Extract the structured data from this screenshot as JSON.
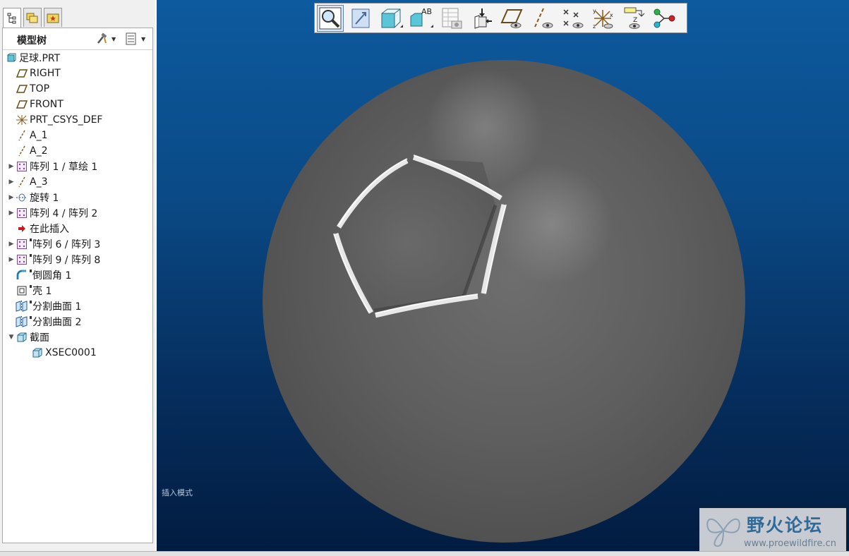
{
  "model_tree": {
    "title": "模型树",
    "items": [
      {
        "label": "足球.PRT",
        "icon": "part-icon",
        "level": 0,
        "expander": ""
      },
      {
        "label": "RIGHT",
        "icon": "datum-plane-icon",
        "level": 1,
        "expander": ""
      },
      {
        "label": "TOP",
        "icon": "datum-plane-icon",
        "level": 1,
        "expander": ""
      },
      {
        "label": "FRONT",
        "icon": "datum-plane-icon",
        "level": 1,
        "expander": ""
      },
      {
        "label": "PRT_CSYS_DEF",
        "icon": "coordinate-system-icon",
        "level": 1,
        "expander": ""
      },
      {
        "label": "A_1",
        "icon": "datum-axis-icon",
        "level": 1,
        "expander": ""
      },
      {
        "label": "A_2",
        "icon": "datum-axis-icon",
        "level": 1,
        "expander": ""
      },
      {
        "label": "阵列 1 / 草绘 1",
        "icon": "pattern-icon",
        "level": 1,
        "expander": "collapsed"
      },
      {
        "label": "A_3",
        "icon": "datum-axis-icon",
        "level": 1,
        "expander": "collapsed"
      },
      {
        "label": "旋转 1",
        "icon": "revolve-icon",
        "level": 1,
        "expander": "collapsed"
      },
      {
        "label": "阵列 4 / 阵列 2",
        "icon": "pattern-icon",
        "level": 1,
        "expander": "collapsed"
      },
      {
        "label": "在此插入",
        "icon": "insert-here-arrow-icon",
        "level": 1,
        "expander": ""
      },
      {
        "label": "阵列 6 / 阵列 3",
        "icon": "pattern-icon",
        "level": 1,
        "expander": "collapsed",
        "badge": true
      },
      {
        "label": "阵列 9 / 阵列 8",
        "icon": "pattern-icon",
        "level": 1,
        "expander": "collapsed",
        "badge": true
      },
      {
        "label": "倒圆角 1",
        "icon": "round-icon",
        "level": 1,
        "expander": "",
        "badge": true
      },
      {
        "label": "壳 1",
        "icon": "shell-icon",
        "level": 1,
        "expander": "",
        "badge": true
      },
      {
        "label": "分割曲面 1",
        "icon": "split-surface-icon",
        "level": 1,
        "expander": "",
        "badge": true
      },
      {
        "label": "分割曲面 2",
        "icon": "split-surface-icon",
        "level": 1,
        "expander": "",
        "badge": true
      },
      {
        "label": "截面",
        "icon": "section-icon",
        "level": 1,
        "expander": "expanded"
      },
      {
        "label": "XSEC0001",
        "icon": "section-icon",
        "level": 2,
        "expander": ""
      }
    ]
  },
  "tabs": [
    {
      "name": "tab-model-tree",
      "icon": "model-tree-icon"
    },
    {
      "name": "tab-folder-browser",
      "icon": "folder-browser-icon"
    },
    {
      "name": "tab-favorites",
      "icon": "favorites-icon"
    }
  ],
  "toolbar": [
    {
      "name": "zoom-in-icon",
      "selected": true
    },
    {
      "name": "refit-icon"
    },
    {
      "name": "shading-icon",
      "dropdown": true
    },
    {
      "name": "saved-views-icon",
      "dropdown": true
    },
    {
      "name": "view-manager-icon"
    },
    {
      "name": "orient-icon"
    },
    {
      "name": "plane-display-icon"
    },
    {
      "name": "axis-display-icon"
    },
    {
      "name": "point-display-icon"
    },
    {
      "name": "csys-display-icon"
    },
    {
      "name": "annotation-display-icon"
    },
    {
      "name": "spin-center-icon"
    }
  ],
  "viewport": {
    "mode_label": "插入模式"
  },
  "watermark": {
    "title": "野火论坛",
    "url": "www.proewildfire.cn"
  },
  "colors": {
    "viewport_top": "#0d5a9e",
    "viewport_bottom": "#021c40",
    "sphere": "#5e5e5e",
    "watermark_text": "#2e6a9a"
  }
}
